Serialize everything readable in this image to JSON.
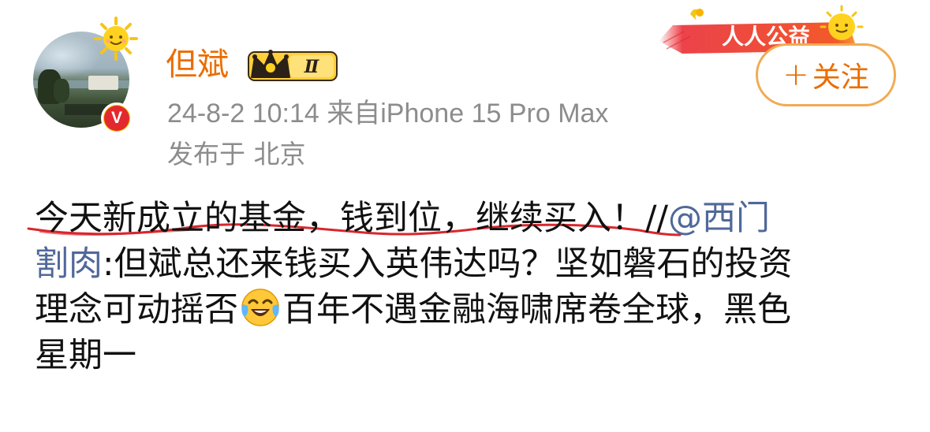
{
  "user": {
    "name": "但斌",
    "level_badge": "Ⅱ",
    "verified_mark": "V"
  },
  "post_meta": {
    "time_source": "24-8-2 10:14  来自iPhone 15 Pro Max",
    "location": "发布于 北京"
  },
  "banner": {
    "text": "人人公益"
  },
  "follow_button": {
    "plus": "+",
    "label": "关注"
  },
  "post": {
    "line1_text": "今天新成立的基金，钱到位，继续买入！//",
    "line1_mention": "@西门",
    "line2_mention": "割肉",
    "line2_text": ":但斌总还来钱买入英伟达吗？坚如磐石的投资",
    "line3_text_a": "理念可动摇否",
    "line3_text_b": "百年不遇金融海啸席卷全球，黑色",
    "line4_text": "星期一",
    "emoji": "laugh-cry-emoji-icon"
  },
  "colors": {
    "username": "#ea6d00",
    "meta": "#8c8c8c",
    "mention": "#50689a",
    "follow_border": "#f1ab52",
    "underline_scribble": "#d8272d"
  }
}
